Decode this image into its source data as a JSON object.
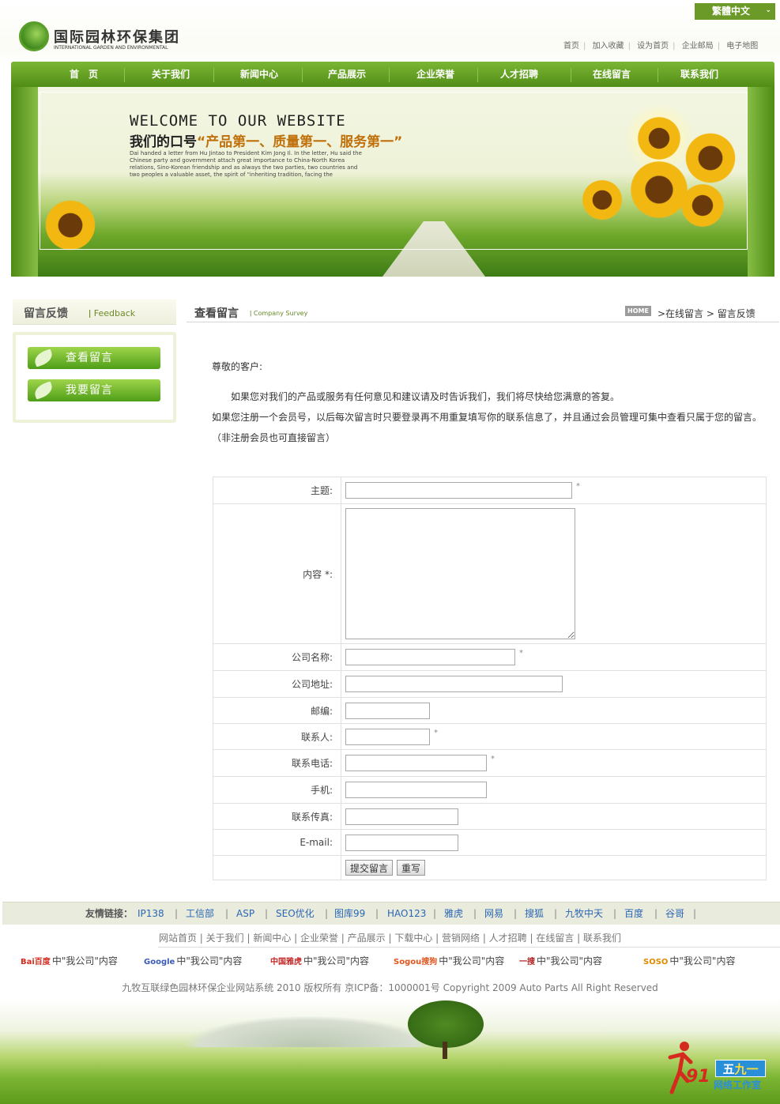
{
  "header": {
    "lang_button": "繁體中文",
    "logo_cn": "国际园林环保集团",
    "logo_en": "INTERNATIONAL GARDEN AND ENVIRONMENTAL",
    "top_links": [
      "首页",
      "加入收藏",
      "设为首页",
      "企业邮局",
      "电子地图"
    ]
  },
  "nav": [
    "首　页",
    "关于我们",
    "新闻中心",
    "产品展示",
    "企业荣誉",
    "人才招聘",
    "在线留言",
    "联系我们"
  ],
  "banner": {
    "welcome": "WELCOME TO OUR WEBSITE",
    "slogan_prefix": "我们的口号",
    "slogan_highlight": "“产品第一、质量第一、服务第一”",
    "description": "Dai handed a letter from Hu Jintao to President Kim Jong Il. In the letter, Hu said the Chinese party and government attach great importance to China-North Korea relations, Sino-Korean friendship and as always the two parties, two countries and two peoples a valuable asset, the spirit of \"inheriting tradition, facing the"
  },
  "sidebar": {
    "title": "留言反馈",
    "subtitle": "Feedback",
    "buttons": [
      "查看留言",
      "我要留言"
    ]
  },
  "main": {
    "title": "查看留言",
    "subtitle": "Company Survey",
    "home_badge": "HOME",
    "breadcrumb": ">在线留言 > 留言反馈",
    "greeting": "尊敬的客户:",
    "para1": "如果您对我们的产品或服务有任何意见和建议请及时告诉我们，我们将尽快给您满意的答复。",
    "para2": "如果您注册一个会员号，以后每次留言时只要登录再不用重复填写你的联系信息了，并且通过会员管理可集中查看只属于您的留言。",
    "para3": "（非注册会员也可直接留言）"
  },
  "form": {
    "subject_label": "主题:",
    "content_label": "内容 *:",
    "company_label": "公司名称:",
    "address_label": "公司地址:",
    "zip_label": "邮编:",
    "contact_label": "联系人:",
    "phone_label": "联系电话:",
    "mobile_label": "手机:",
    "fax_label": "联系传真:",
    "email_label": "E-mail:",
    "required_mark": "*",
    "submit_button": "提交留言",
    "reset_button": "重写"
  },
  "footer": {
    "friend_title": "友情链接：",
    "friend_links": [
      "IP138",
      "工信部",
      "ASP",
      "SEO优化",
      "图库99",
      "HAO123",
      "雅虎",
      "网易",
      "搜狐",
      "九牧中天",
      "百度",
      "谷哥"
    ],
    "friend_sep": "|",
    "nav_text": "网站首页 | 关于我们 | 新闻中心 | 企业荣誉 | 产品展示 | 下载中心 | 营销网络 | 人才招聘 | 在线留言 | 联系我们",
    "engines": [
      {
        "logo": "Bai百度",
        "text": "中\"我公司\"内容",
        "color": "#d52b1e"
      },
      {
        "logo": "Google",
        "text": "中\"我公司\"内容",
        "color": "#3b5bb5"
      },
      {
        "logo": "中国雅虎",
        "text": "中\"我公司\"内容",
        "color": "#c62828"
      },
      {
        "logo": "Sogou搜狗",
        "text": "中\"我公司\"内容",
        "color": "#e0561f"
      },
      {
        "logo": "一搜",
        "text": "中\"我公司\"内容",
        "color": "#b22222"
      },
      {
        "logo": "SOSO",
        "text": "中\"我公司\"内容",
        "color": "#e08a00"
      }
    ],
    "copyright": "九牧互联绿色园林环保企业网站系统 2010 版权所有 京ICP备：1000001号 Copyright 2009 Auto Parts All Right Reserved"
  },
  "watermark": {
    "num": "91",
    "box_left": "五",
    "box_right": "九一",
    "text": "网络工作室"
  }
}
